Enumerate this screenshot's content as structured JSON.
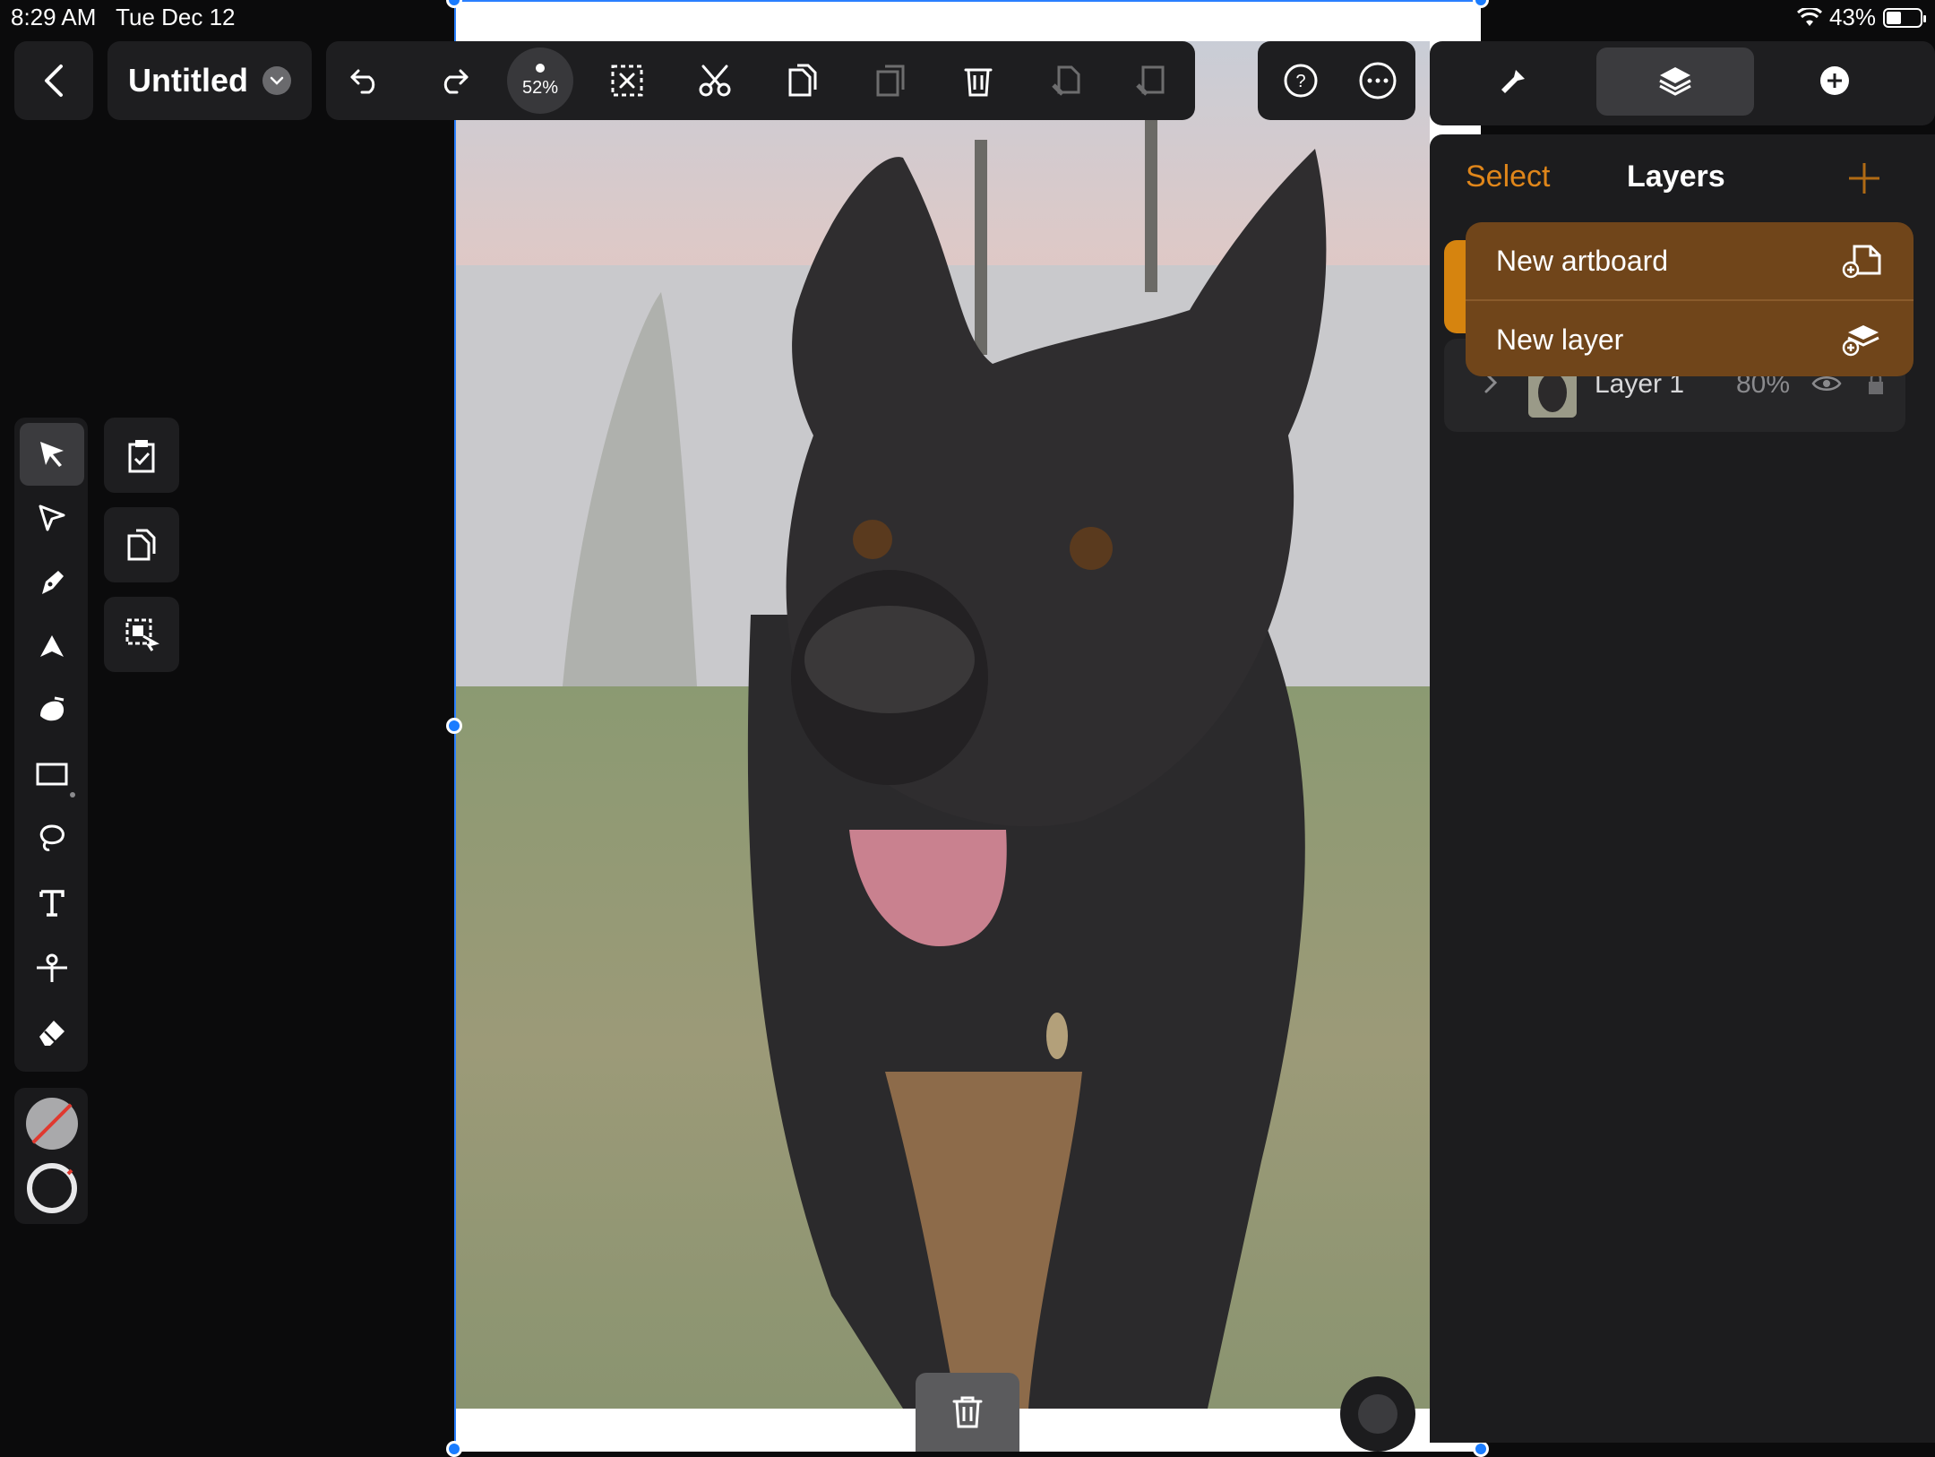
{
  "status": {
    "time": "8:29 AM",
    "date": "Tue Dec 12",
    "battery": "43%",
    "battery_level": 0.43
  },
  "document": {
    "title": "Untitled",
    "zoom": "52%"
  },
  "toolbar": {
    "icons": [
      "back-icon",
      "undo-icon",
      "redo-icon",
      "deselect-icon",
      "cut-icon",
      "copy-icon",
      "paste-icon",
      "delete-icon",
      "paste-in-place-icon",
      "paste-style-icon",
      "help-icon",
      "more-icon"
    ]
  },
  "panel": {
    "tabs": [
      "design-icon",
      "layers-icon",
      "add-icon"
    ],
    "select_label": "Select",
    "title": "Layers",
    "accent": "#e0861a"
  },
  "menu": {
    "items": [
      {
        "label": "New artboard",
        "icon": "new-artboard-icon"
      },
      {
        "label": "New layer",
        "icon": "new-layer-icon"
      }
    ]
  },
  "layers": [
    {
      "name": "Layer 1",
      "opacity": "80%"
    }
  ],
  "tools": [
    "select-tool",
    "node-tool",
    "pen-tool",
    "vector-brush-tool",
    "shape-builder-tool",
    "rectangle-tool",
    "lasso-tool",
    "text-tool",
    "knife-tool",
    "eraser-tool"
  ],
  "colors": {
    "fill": "none",
    "stroke": "#e0e0e0",
    "selection": "#1a7cff"
  }
}
